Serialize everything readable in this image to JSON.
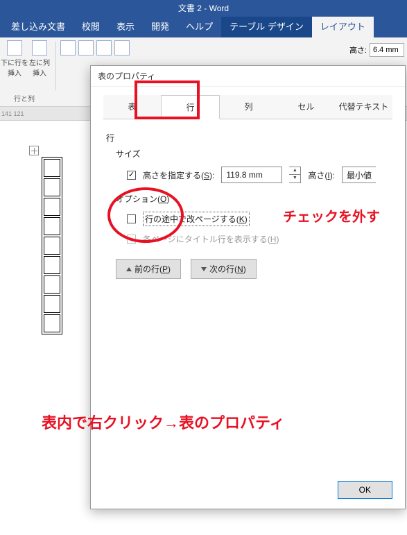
{
  "titlebar": "文書 2 - Word",
  "ribbon": {
    "tabs": [
      "差し込み文書",
      "校閲",
      "表示",
      "開発",
      "ヘルプ",
      "テーブル デザイン",
      "レイアウト"
    ],
    "active_tab_index": 5,
    "layout_tab_index": 6,
    "insert_below": "下に行を\n挿入",
    "insert_left": "左に列\n挿入",
    "group_label": "行と列",
    "height_label": "高さ:",
    "height_value": "6.4 mm"
  },
  "ruler": {
    "marks": "141  121"
  },
  "dialog": {
    "title": "表のプロパティ",
    "tabs": [
      "表",
      "行",
      "列",
      "セル",
      "代替テキスト"
    ],
    "active_tab_index": 1,
    "row_label": "行",
    "size_label": "サイズ",
    "specify_height_label": "高さを指定する(S):",
    "specify_height_checked": true,
    "height_input": "119.8 mm",
    "height_mode_label": "高さ(I):",
    "height_mode_value": "最小値",
    "options_label": "オプション(O)",
    "break_row_label": "行の途中で改ページする(K)",
    "break_row_checked": false,
    "header_row_label": "各ページにタイトル行を表示する(H)",
    "prev_row_btn": "前の行(P)",
    "next_row_btn": "次の行(N)",
    "ok_btn": "OK"
  },
  "annotations": {
    "uncheck": "チェックを外す",
    "rightclick": "表内で右クリック→表のプロパティ"
  }
}
